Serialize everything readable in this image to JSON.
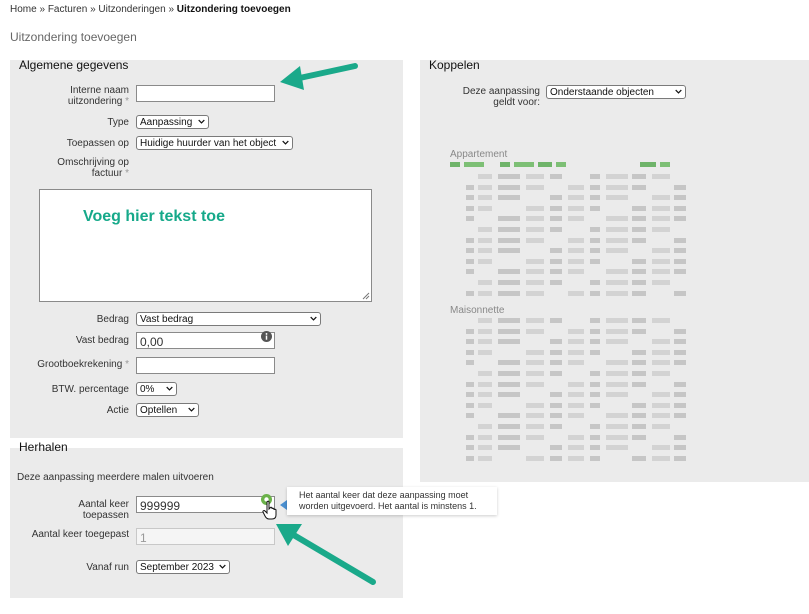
{
  "breadcrumb": {
    "items": [
      "Home",
      "Facturen",
      "Uitzonderingen"
    ],
    "separator": "»",
    "current": "Uitzondering toevoegen"
  },
  "page_title": "Uitzondering toevoegen",
  "general": {
    "title": "Algemene gegevens",
    "internal_name_label": "Interne naam uitzondering",
    "internal_name_value": "",
    "type_label": "Type",
    "type_value": "Aanpassing",
    "apply_on_label": "Toepassen op",
    "apply_on_value": "Huidige huurder van het object",
    "invoice_description_label": "Omschrijving op factuur",
    "invoice_description_placeholder": "Voeg hier tekst toe",
    "amount_label": "Bedrag",
    "amount_value": "Vast bedrag",
    "fixed_amount_label": "Vast bedrag",
    "fixed_amount_value": "0,00",
    "ledger_label": "Grootboekrekening",
    "ledger_value": "",
    "vat_label": "BTW. percentage",
    "vat_value": "0%",
    "action_label": "Actie",
    "action_value": "Optellen",
    "required_marker": "*"
  },
  "repeat": {
    "title": "Herhalen",
    "description": "Deze aanpassing meerdere malen uitvoeren",
    "times_apply_label": "Aantal keer toepassen",
    "times_apply_value": "999999",
    "times_applied_label": "Aantal keer toegepast",
    "times_applied_value": "1",
    "from_run_label": "Vanaf run",
    "from_run_value": "September 2023",
    "tooltip": "Het aantal keer dat deze aanpassing moet worden uitgevoerd. Het aantal is minstens 1."
  },
  "link": {
    "title": "Koppelen",
    "applies_to_label": "Deze aanpassing geldt voor:",
    "applies_to_value": "Onderstaande objecten",
    "groups": [
      "Appartement",
      "Maisonnette"
    ]
  },
  "colors": {
    "panel": "#ebebeb",
    "annotation_arrow": "#1aa98a",
    "hint_text": "#16a98a",
    "tooltip_arrow": "#4a8fd0"
  },
  "icons": [
    "info-icon",
    "help-icon",
    "hand-cursor-icon",
    "chevron-down-icon",
    "resize-handle-icon"
  ]
}
